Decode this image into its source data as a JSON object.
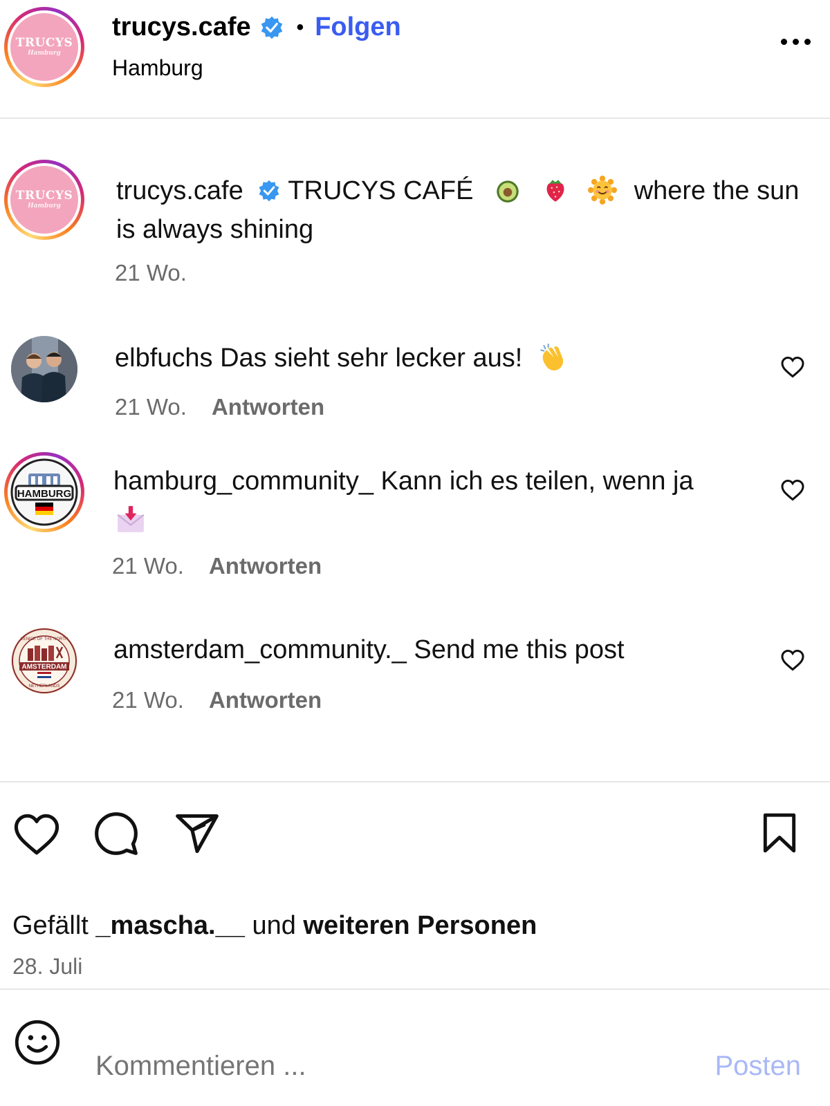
{
  "header": {
    "username": "trucys.cafe",
    "separator": "•",
    "follow_label": "Folgen",
    "location": "Hamburg",
    "avatar_logo_text": "TRUCYS",
    "avatar_logo_sub": "Hamburg"
  },
  "caption": {
    "username": "trucys.cafe",
    "text_part1": "TRUCYS CAFÉ",
    "emojis": [
      "avocado-emoji",
      "strawberry-emoji",
      "smiling-sun-emoji"
    ],
    "text_part2": "where the sun is always shining",
    "time": "21 Wo."
  },
  "comments": [
    {
      "username": "elbfuchs",
      "text": "Das sieht sehr lecker aus!",
      "emoji": "clapping-hands-emoji",
      "time": "21 Wo.",
      "reply_label": "Antworten"
    },
    {
      "username": "hamburg_community_",
      "text": "Kann ich es teilen, wenn ja",
      "emoji": "envelope-with-arrow-emoji",
      "time": "21 Wo.",
      "reply_label": "Antworten",
      "avatar_text": "HAMBURG"
    },
    {
      "username": "amsterdam_community._",
      "text": "Send me this post",
      "time": "21 Wo.",
      "reply_label": "Antworten",
      "avatar_text": "AMSTERDAM",
      "avatar_ring_top": "VENICE OF THE NORTH",
      "avatar_ring_bottom": "NETHERLANDS"
    }
  ],
  "actions": {
    "like_icon": "heart-icon",
    "comment_icon": "comment-bubble-icon",
    "share_icon": "paper-plane-icon",
    "save_icon": "bookmark-icon"
  },
  "likes": {
    "prefix": "Gefällt",
    "user": "_mascha.__",
    "middle": "und",
    "suffix": "weiteren Personen"
  },
  "date": "28. Juli",
  "comment_box": {
    "placeholder": "Kommentieren ...",
    "post_label": "Posten",
    "emoji_icon": "smiley-icon"
  },
  "colors": {
    "follow": "#3a5cf0",
    "verified": "#3897f0",
    "post_disabled": "#a9b8f6",
    "secondary_text": "#6b6b6b"
  }
}
